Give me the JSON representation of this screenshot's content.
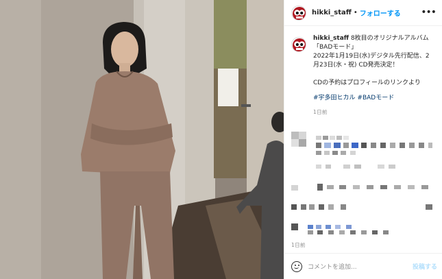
{
  "post": {
    "username": "hikki_staff",
    "dot": "•",
    "follow_label": "フォローする",
    "more_icon": "more-horizontal-icon",
    "caption_lines": [
      "8枚目のオリジナルアルバム",
      "「BADモード」",
      "2022年1月19日(水)デジタル先行配信、2",
      "月23日(水・祝) CD発売決定！"
    ],
    "caption_link_line": "CDの予約はプロフィールのリンクより",
    "hashtags": "#宇多田ヒカル #BADモード",
    "caption_time": "1日前",
    "comment_time": "1日前"
  },
  "comment_box": {
    "placeholder": "コメントを追加...",
    "post_label": "投稿する"
  },
  "colors": {
    "link_blue": "#0095f6",
    "hashtag_blue": "#00376b",
    "muted_gray": "#8e8e8e",
    "disabled_blue": "#b2dffc"
  }
}
